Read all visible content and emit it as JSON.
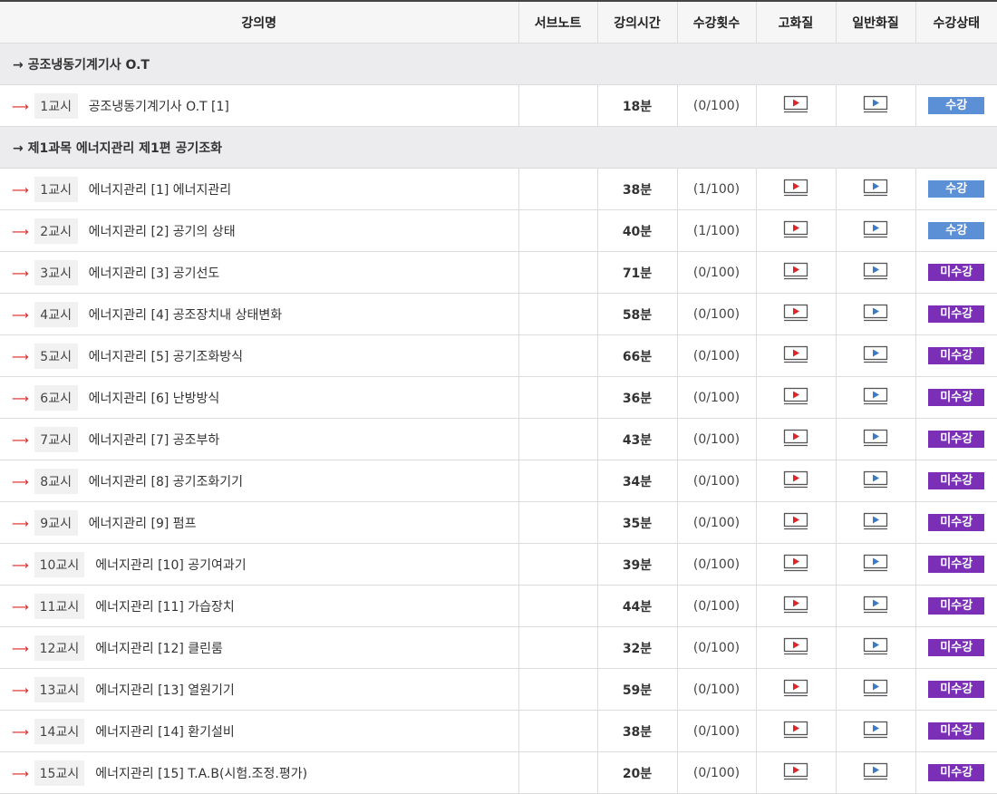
{
  "headers": [
    "강의명",
    "서브노트",
    "강의시간",
    "수강횟수",
    "고화질",
    "일반화질",
    "수강상태"
  ],
  "icons": {
    "hq": "play-video-icon",
    "normal": "play-video-icon"
  },
  "colors": {
    "status_done": "#5b8fd6",
    "status_todo": "#7b2fb6",
    "arrow": "#e02424"
  },
  "sections": [
    {
      "title": "→ 공조냉동기계기사 O.T",
      "lessons": [
        {
          "period": "1교시",
          "title": "공조냉동기계기사 O.T [1]",
          "time": "18분",
          "count": "(0/100)",
          "status": "수강",
          "done": true
        }
      ]
    },
    {
      "title": "→ 제1과목 에너지관리 제1편 공기조화",
      "lessons": [
        {
          "period": "1교시",
          "title": "에너지관리 [1] 에너지관리",
          "time": "38분",
          "count": "(1/100)",
          "status": "수강",
          "done": true
        },
        {
          "period": "2교시",
          "title": "에너지관리 [2] 공기의 상태",
          "time": "40분",
          "count": "(1/100)",
          "status": "수강",
          "done": true
        },
        {
          "period": "3교시",
          "title": "에너지관리 [3] 공기선도",
          "time": "71분",
          "count": "(0/100)",
          "status": "미수강",
          "done": false
        },
        {
          "period": "4교시",
          "title": "에너지관리 [4] 공조장치내 상태변화",
          "time": "58분",
          "count": "(0/100)",
          "status": "미수강",
          "done": false
        },
        {
          "period": "5교시",
          "title": "에너지관리 [5] 공기조화방식",
          "time": "66분",
          "count": "(0/100)",
          "status": "미수강",
          "done": false
        },
        {
          "period": "6교시",
          "title": "에너지관리 [6] 난방방식",
          "time": "36분",
          "count": "(0/100)",
          "status": "미수강",
          "done": false
        },
        {
          "period": "7교시",
          "title": "에너지관리 [7] 공조부하",
          "time": "43분",
          "count": "(0/100)",
          "status": "미수강",
          "done": false
        },
        {
          "period": "8교시",
          "title": "에너지관리 [8] 공기조화기기",
          "time": "34분",
          "count": "(0/100)",
          "status": "미수강",
          "done": false
        },
        {
          "period": "9교시",
          "title": "에너지관리 [9] 펌프",
          "time": "35분",
          "count": "(0/100)",
          "status": "미수강",
          "done": false
        },
        {
          "period": "10교시",
          "title": "에너지관리 [10] 공기여과기",
          "time": "39분",
          "count": "(0/100)",
          "status": "미수강",
          "done": false
        },
        {
          "period": "11교시",
          "title": "에너지관리 [11] 가습장치",
          "time": "44분",
          "count": "(0/100)",
          "status": "미수강",
          "done": false
        },
        {
          "period": "12교시",
          "title": "에너지관리 [12] 클린룸",
          "time": "32분",
          "count": "(0/100)",
          "status": "미수강",
          "done": false
        },
        {
          "period": "13교시",
          "title": "에너지관리 [13] 열원기기",
          "time": "59분",
          "count": "(0/100)",
          "status": "미수강",
          "done": false
        },
        {
          "period": "14교시",
          "title": "에너지관리 [14] 환기설비",
          "time": "38분",
          "count": "(0/100)",
          "status": "미수강",
          "done": false
        },
        {
          "period": "15교시",
          "title": "에너지관리 [15] T.A.B(시험.조정.평가)",
          "time": "20분",
          "count": "(0/100)",
          "status": "미수강",
          "done": false
        }
      ]
    }
  ]
}
